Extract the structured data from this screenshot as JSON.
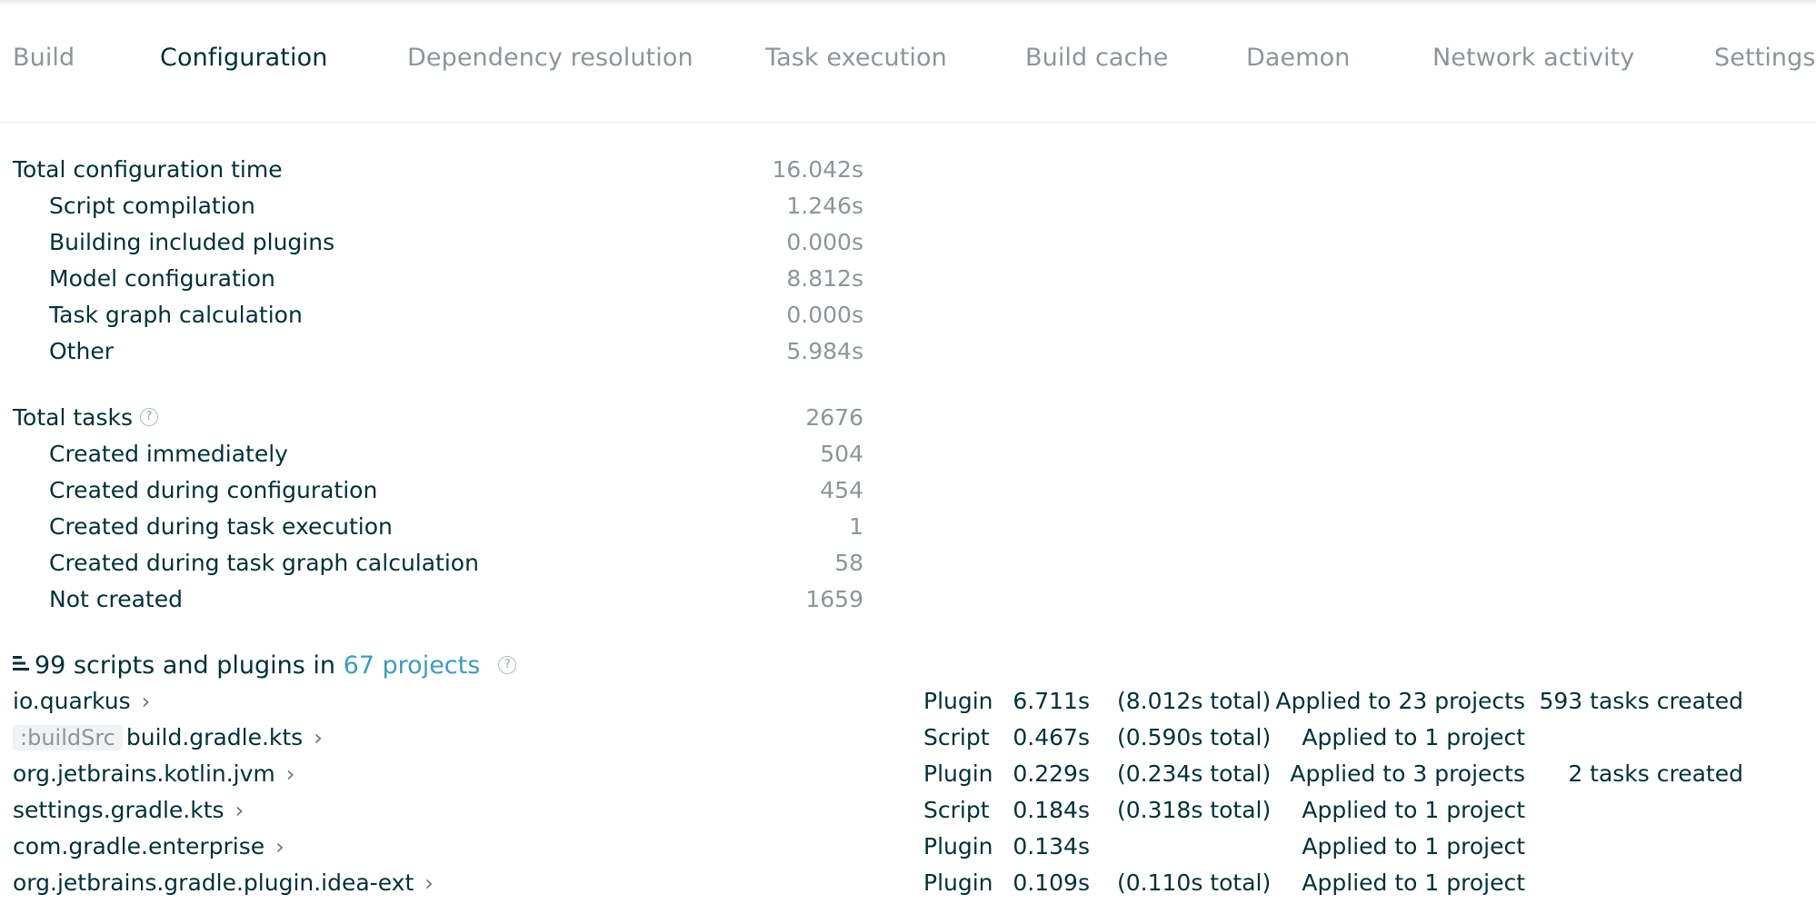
{
  "tabs": [
    {
      "label": "Build",
      "active": false
    },
    {
      "label": "Configuration",
      "active": true
    },
    {
      "label": "Dependency resolution",
      "active": false
    },
    {
      "label": "Task execution",
      "active": false
    },
    {
      "label": "Build cache",
      "active": false
    },
    {
      "label": "Daemon",
      "active": false
    },
    {
      "label": "Network activity",
      "active": false
    },
    {
      "label": "Settings a",
      "active": false
    }
  ],
  "config_time": {
    "total_label": "Total configuration time",
    "total_value": "16.042s",
    "items": [
      {
        "label": "Script compilation",
        "value": "1.246s"
      },
      {
        "label": "Building included plugins",
        "value": "0.000s"
      },
      {
        "label": "Model configuration",
        "value": "8.812s"
      },
      {
        "label": "Task graph calculation",
        "value": "0.000s"
      },
      {
        "label": "Other",
        "value": "5.984s"
      }
    ]
  },
  "tasks": {
    "total_label": "Total tasks",
    "total_value": "2676",
    "help_icon": "question-circle-icon",
    "items": [
      {
        "label": "Created immediately",
        "value": "504"
      },
      {
        "label": "Created during configuration",
        "value": "454"
      },
      {
        "label": "Created during task execution",
        "value": "1"
      },
      {
        "label": "Created during task graph calculation",
        "value": "58"
      },
      {
        "label": "Not created",
        "value": "1659"
      }
    ]
  },
  "scripts": {
    "header_count": "99 scripts and plugins",
    "header_in": "in",
    "header_projects": "67 projects",
    "rows": [
      {
        "badge": "",
        "name": "io.quarkus",
        "type": "Plugin",
        "time": "6.711s",
        "total": "(8.012s total)",
        "applied": "Applied to 23 projects",
        "tasks": "593 tasks created"
      },
      {
        "badge": ":buildSrc",
        "name": "build.gradle.kts",
        "type": "Script",
        "time": "0.467s",
        "total": "(0.590s total)",
        "applied": "Applied to 1 project",
        "tasks": ""
      },
      {
        "badge": "",
        "name": "org.jetbrains.kotlin.jvm",
        "type": "Plugin",
        "time": "0.229s",
        "total": "(0.234s total)",
        "applied": "Applied to 3 projects",
        "tasks": "2 tasks created"
      },
      {
        "badge": "",
        "name": "settings.gradle.kts",
        "type": "Script",
        "time": "0.184s",
        "total": "(0.318s total)",
        "applied": "Applied to 1 project",
        "tasks": ""
      },
      {
        "badge": "",
        "name": "com.gradle.enterprise",
        "type": "Plugin",
        "time": "0.134s",
        "total": "",
        "applied": "Applied to 1 project",
        "tasks": ""
      },
      {
        "badge": "",
        "name": "org.jetbrains.gradle.plugin.idea-ext",
        "type": "Plugin",
        "time": "0.109s",
        "total": "(0.110s total)",
        "applied": "Applied to 1 project",
        "tasks": ""
      }
    ]
  },
  "colors": {
    "text": "#02303a",
    "muted": "#8d9598",
    "link": "#3e9cb8"
  }
}
